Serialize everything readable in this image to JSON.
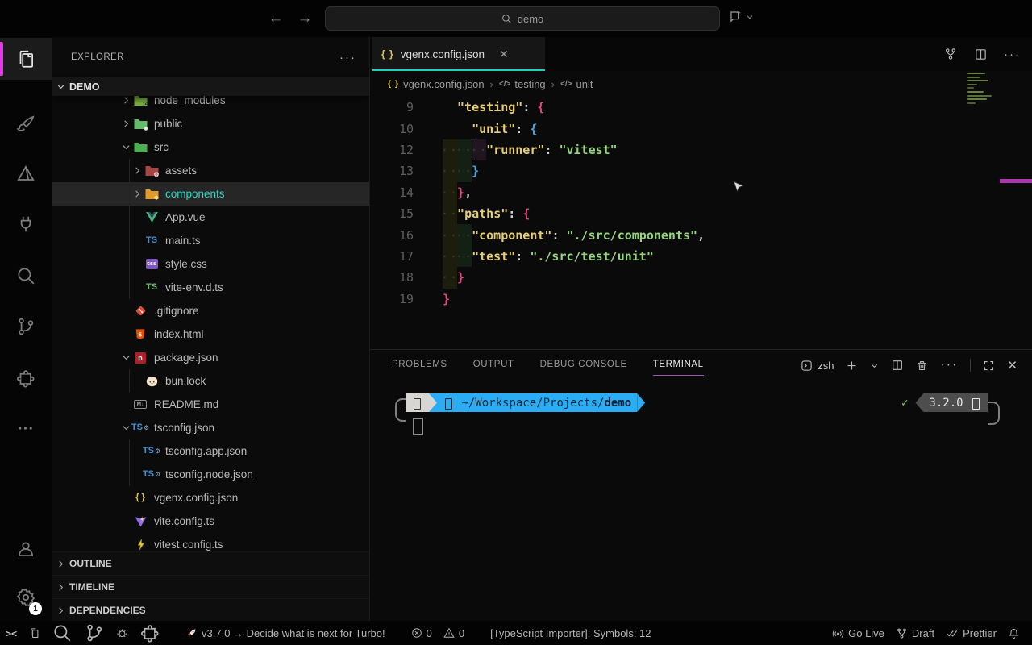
{
  "titlebar": {
    "search_value": "demo"
  },
  "activity_bar": {
    "items": [
      {
        "name": "explorer",
        "active": true
      },
      {
        "name": "brush",
        "active": false
      },
      {
        "name": "pyramid",
        "active": false
      },
      {
        "name": "plug",
        "active": false
      },
      {
        "name": "search",
        "active": false
      },
      {
        "name": "source-control",
        "active": false
      },
      {
        "name": "extensions",
        "active": false
      },
      {
        "name": "more",
        "active": false
      }
    ],
    "bottom_items": [
      {
        "name": "account",
        "active": false
      },
      {
        "name": "settings",
        "active": false,
        "badge": "1"
      }
    ]
  },
  "explorer": {
    "title": "EXPLORER",
    "actions_label": "···",
    "section": "DEMO",
    "tree": [
      {
        "label": "node_modules",
        "icon": "folder-node",
        "chevron": "right",
        "depth": 0,
        "clipped": true
      },
      {
        "label": "public",
        "icon": "folder-public",
        "chevron": "right",
        "depth": 0
      },
      {
        "label": "src",
        "icon": "folder-src",
        "chevron": "down",
        "depth": 0
      },
      {
        "label": "assets",
        "icon": "folder-assets",
        "chevron": "right",
        "depth": 1
      },
      {
        "label": "components",
        "icon": "folder-components",
        "chevron": "right",
        "depth": 1,
        "selected": true
      },
      {
        "label": "App.vue",
        "icon": "vue",
        "depth": 1
      },
      {
        "label": "main.ts",
        "icon": "ts-blue",
        "depth": 1
      },
      {
        "label": "style.css",
        "icon": "css",
        "depth": 1
      },
      {
        "label": "vite-env.d.ts",
        "icon": "ts-green",
        "depth": 1
      },
      {
        "label": ".gitignore",
        "icon": "git",
        "depth": 0
      },
      {
        "label": "index.html",
        "icon": "html",
        "depth": 0
      },
      {
        "label": "package.json",
        "icon": "npm",
        "chevron": "down",
        "depth": 0
      },
      {
        "label": "bun.lock",
        "icon": "bun",
        "depth": 1
      },
      {
        "label": "README.md",
        "icon": "markdown",
        "depth": 0
      },
      {
        "label": "tsconfig.json",
        "icon": "tsconfig",
        "chevron": "down",
        "depth": 0
      },
      {
        "label": "tsconfig.app.json",
        "icon": "tsconfig",
        "depth": 1
      },
      {
        "label": "tsconfig.node.json",
        "icon": "tsconfig",
        "depth": 1
      },
      {
        "label": "vgenx.config.json",
        "icon": "json-braces",
        "depth": 0
      },
      {
        "label": "vite.config.ts",
        "icon": "vite",
        "depth": 0
      },
      {
        "label": "vitest.config.ts",
        "icon": "vitest",
        "depth": 0
      }
    ],
    "bottom_sections": [
      {
        "label": "OUTLINE"
      },
      {
        "label": "TIMELINE"
      },
      {
        "label": "DEPENDENCIES"
      }
    ]
  },
  "editor": {
    "tab": {
      "title": "vgenx.config.json",
      "close_label": "✕"
    },
    "breadcrumbs": [
      {
        "icon": "json-braces",
        "label": "vgenx.config.json"
      },
      {
        "icon": "code-tag",
        "label": "testing"
      },
      {
        "icon": "code-tag",
        "label": "unit"
      }
    ],
    "code": {
      "lines": [
        {
          "n": "9",
          "pads": [
            null
          ],
          "tokens": [
            [
              "k",
              "\"testing\""
            ],
            [
              "p",
              ": "
            ],
            [
              "b1",
              "{"
            ]
          ]
        },
        {
          "n": "10",
          "pads": [
            null,
            null
          ],
          "tokens": [
            [
              "k",
              "\"unit\""
            ],
            [
              "p",
              ": "
            ],
            [
              "b2",
              "{"
            ]
          ]
        },
        {
          "n": "12",
          "pads": [
            "olive",
            "green",
            "purple"
          ],
          "tokens": [
            [
              "k",
              "\"runner\""
            ],
            [
              "p",
              ": "
            ],
            [
              "s",
              "\"vitest\""
            ]
          ]
        },
        {
          "n": "13",
          "pads": [
            "olive",
            "green"
          ],
          "tokens": [
            [
              "b2",
              "}"
            ]
          ]
        },
        {
          "n": "14",
          "pads": [
            "olive"
          ],
          "tokens": [
            [
              "b1",
              "}"
            ],
            [
              "p",
              ","
            ]
          ]
        },
        {
          "n": "15",
          "pads": [
            "olive"
          ],
          "tokens": [
            [
              "k",
              "\"paths\""
            ],
            [
              "p",
              ": "
            ],
            [
              "b1",
              "{"
            ]
          ]
        },
        {
          "n": "16",
          "pads": [
            "olive",
            "green"
          ],
          "tokens": [
            [
              "k",
              "\"component\""
            ],
            [
              "p",
              ": "
            ],
            [
              "s",
              "\"./src/components\""
            ],
            [
              "p",
              ","
            ]
          ]
        },
        {
          "n": "17",
          "pads": [
            "olive",
            "green"
          ],
          "tokens": [
            [
              "k",
              "\"test\""
            ],
            [
              "p",
              ": "
            ],
            [
              "s",
              "\"./src/test/unit\""
            ]
          ]
        },
        {
          "n": "18",
          "pads": [
            "olive"
          ],
          "tokens": [
            [
              "b1",
              "}"
            ]
          ]
        },
        {
          "n": "19",
          "pads": [],
          "tokens": [
            [
              "b1",
              "}"
            ]
          ]
        }
      ]
    }
  },
  "panel": {
    "tabs": [
      {
        "label": "PROBLEMS",
        "active": false
      },
      {
        "label": "OUTPUT",
        "active": false
      },
      {
        "label": "DEBUG CONSOLE",
        "active": false
      },
      {
        "label": "TERMINAL",
        "active": true
      }
    ],
    "shell_label": "zsh",
    "terminal": {
      "path_prefix": "~/Workspace/Projects/",
      "path_bold": "demo",
      "status_check": "✓",
      "version": "3.2.0"
    }
  },
  "status_bar": {
    "left": [
      {
        "icon": "remote",
        "text": ""
      },
      {
        "icon": "files",
        "text": ""
      },
      {
        "icon": "search",
        "text": ""
      },
      {
        "icon": "source-control",
        "text": ""
      },
      {
        "icon": "debug",
        "text": ""
      },
      {
        "icon": "extensions",
        "text": ""
      },
      {
        "icon": "rocket",
        "text": "v3.7.0 → Decide what is next for Turbo!"
      },
      {
        "icon": "error",
        "text": "0"
      },
      {
        "icon": "warning",
        "text": "0"
      },
      {
        "icon": "",
        "text": "[TypeScript Importer]: Symbols: 12"
      }
    ],
    "right": [
      {
        "icon": "broadcast",
        "text": "Go Live"
      },
      {
        "icon": "fork",
        "text": "Draft"
      },
      {
        "icon": "double-check",
        "text": "Prettier"
      },
      {
        "icon": "bell",
        "text": ""
      }
    ]
  }
}
